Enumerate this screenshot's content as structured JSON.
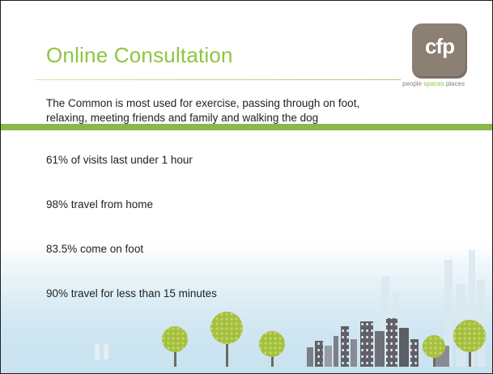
{
  "slide": {
    "title": "Online Consultation",
    "logo": {
      "text": "cfp",
      "tagline_1": "people ",
      "tagline_2": "spaces",
      "tagline_3": " places"
    },
    "intro_line_1": "The Common is most used for exercise, passing through on foot,",
    "intro_line_2": "relaxing, meeting friends and family and walking the dog",
    "stats": [
      "61% of visits last under 1 hour",
      "98% travel from home",
      "83.5% come on foot",
      "90% travel for less than 15 minutes"
    ]
  },
  "colors": {
    "title": "#8dc63f",
    "logo_box": "#8c7f74",
    "tree_canopy": "#a4bf3d",
    "ground": "#8ab84a",
    "buildings": "#6b6b72"
  },
  "icons": [
    "tree-icon",
    "building-icon",
    "figure-icon"
  ]
}
